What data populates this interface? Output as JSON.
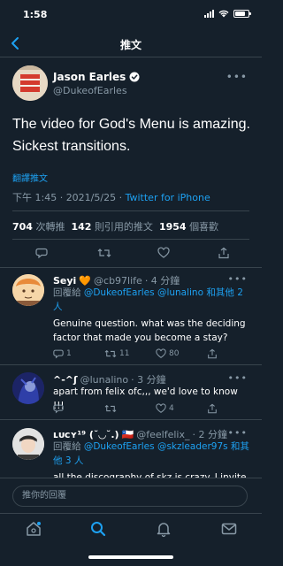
{
  "status": {
    "time": "1:58"
  },
  "nav": {
    "title": "推文"
  },
  "tweet": {
    "author_name": "Jason Earles",
    "author_handle": "@DukeofEarles",
    "text": "The video for God's Menu is amazing. Sickest transitions.",
    "translate": "翻譯推文",
    "time": "下午 1:45 · 2021/5/25 · ",
    "client": "Twitter for iPhone",
    "stats": {
      "retweets": "704",
      "retweets_label": "次轉推",
      "quotes": "142",
      "quotes_label": "則引用的推文",
      "likes": "1954",
      "likes_label": "個喜歡"
    }
  },
  "replies": [
    {
      "name": "Seyi",
      "emoji": "🧡",
      "handle": "@cb97life",
      "time": "· 4 分鐘",
      "reply_to_prefix": "回覆給",
      "reply_to": "@DukeofEarles @lunalino 和其他 2 人",
      "text": "Genuine question. what was the deciding factor that made you become a stay?",
      "counts": {
        "replies": "1",
        "retweets": "11",
        "likes": "80"
      }
    },
    {
      "name": "^-^ʃ",
      "handle": "@lunalino",
      "time": "· 3 分鐘",
      "text": "apart from felix ofc,,, we'd love to know !!!",
      "counts": {
        "replies": "",
        "retweets": "",
        "likes": "4"
      }
    },
    {
      "name": "ʟᴜᴄʏ¹⁹ (˘◡˘.)",
      "flag": "🇨🇱",
      "handle": "@feelfelix_",
      "time": "· 2 分鐘",
      "reply_to_prefix": "回覆給",
      "reply_to": "@DukeofEarles @skzleader97s 和其他 3 人",
      "text": "all the discography of skz is crazy. I invite"
    }
  ],
  "compose": {
    "placeholder": "推你的回覆"
  },
  "colors": {
    "background": "#15202b",
    "accent": "#1da1f2",
    "muted": "#8899a6",
    "like": "#e0245e"
  },
  "icons": [
    "back-arrow-icon",
    "verified-badge-icon",
    "more-icon",
    "reply-icon",
    "retweet-icon",
    "like-icon",
    "share-icon",
    "home-icon",
    "search-icon",
    "notifications-icon",
    "messages-icon"
  ]
}
